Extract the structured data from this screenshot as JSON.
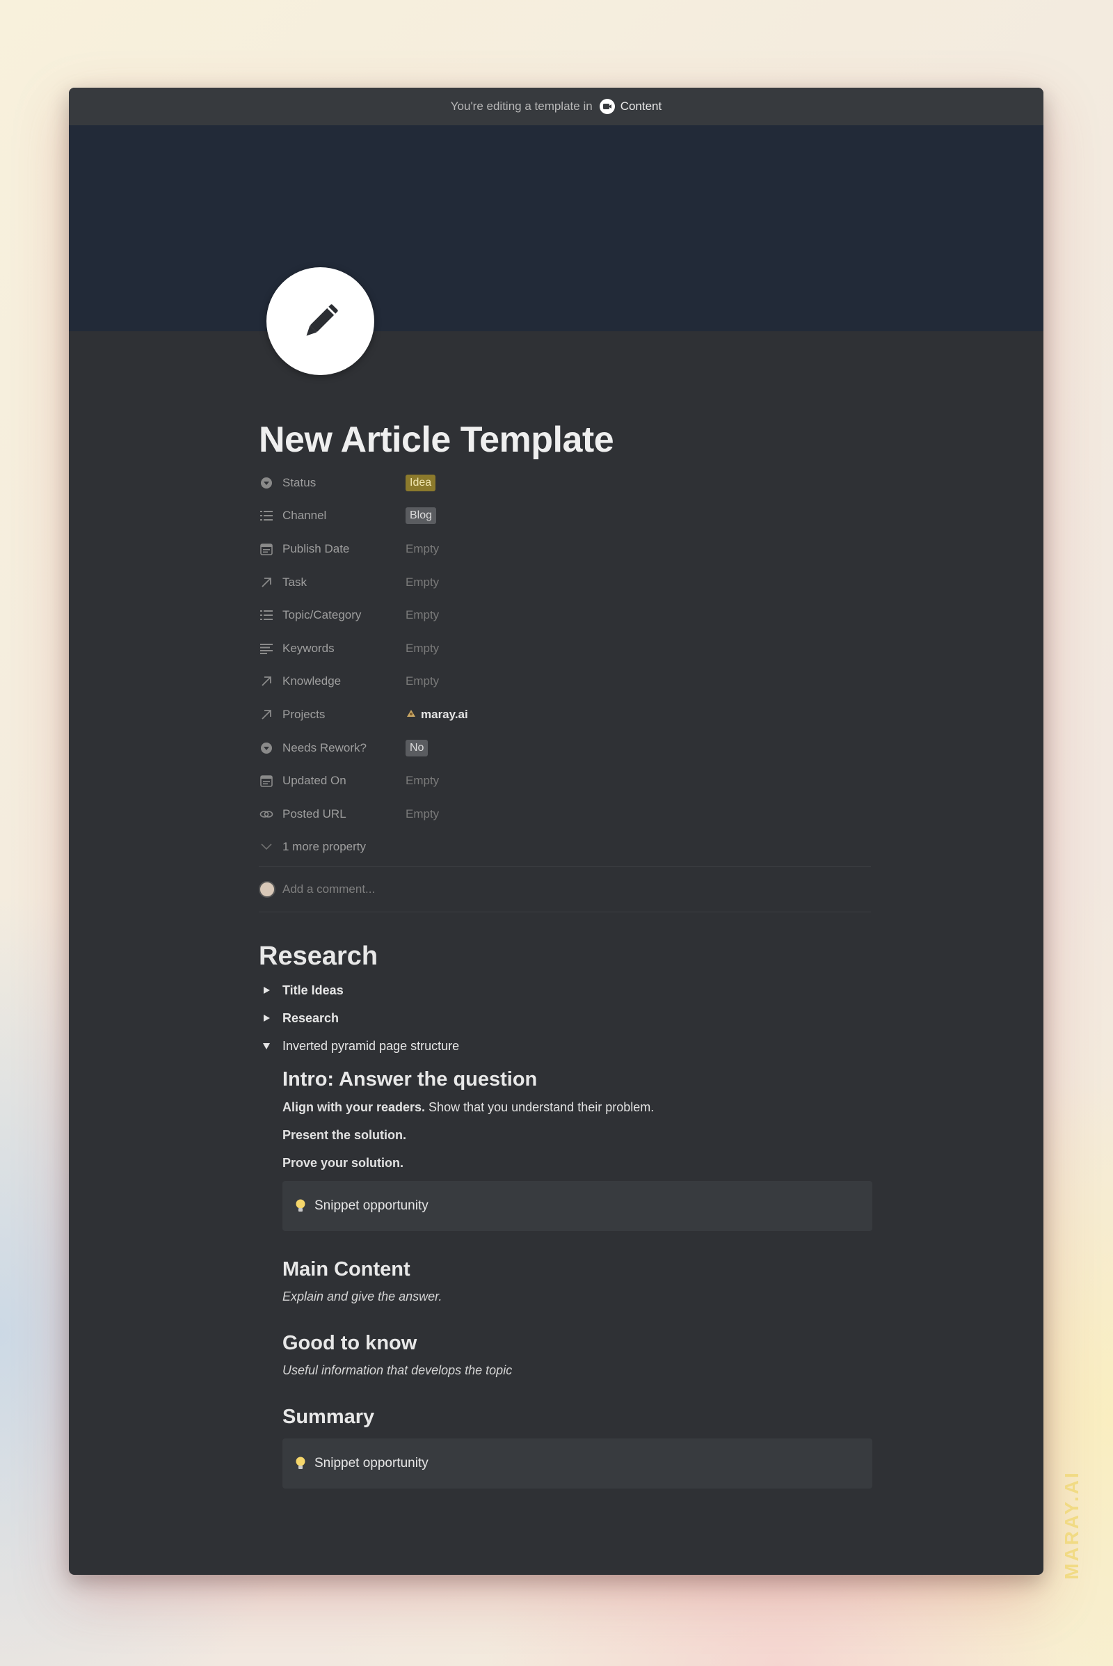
{
  "banner": {
    "prefix": "You're editing a template in",
    "workspace": "Content"
  },
  "page": {
    "icon": "pencil-icon",
    "title": "New Article Template"
  },
  "properties": [
    {
      "name": "Status",
      "icon": "status-icon",
      "value": "Idea",
      "kind": "tag-yellow"
    },
    {
      "name": "Channel",
      "icon": "list-icon",
      "value": "Blog",
      "kind": "tag-gray"
    },
    {
      "name": "Publish Date",
      "icon": "calendar-icon",
      "value": "Empty",
      "kind": "empty"
    },
    {
      "name": "Task",
      "icon": "relation-arrow-icon",
      "value": "Empty",
      "kind": "empty"
    },
    {
      "name": "Topic/Category",
      "icon": "list-icon",
      "value": "Empty",
      "kind": "empty"
    },
    {
      "name": "Keywords",
      "icon": "text-icon",
      "value": "Empty",
      "kind": "empty"
    },
    {
      "name": "Knowledge",
      "icon": "relation-arrow-icon",
      "value": "Empty",
      "kind": "empty"
    },
    {
      "name": "Projects",
      "icon": "relation-arrow-icon",
      "value": "maray.ai",
      "kind": "relation"
    },
    {
      "name": "Needs Rework?",
      "icon": "status-icon",
      "value": "No",
      "kind": "tag-gray"
    },
    {
      "name": "Updated On",
      "icon": "calendar-icon",
      "value": "Empty",
      "kind": "empty"
    },
    {
      "name": "Posted URL",
      "icon": "link-icon",
      "value": "Empty",
      "kind": "empty"
    }
  ],
  "more_property": "1 more property",
  "comment_placeholder": "Add a comment...",
  "body": {
    "heading": "Research",
    "toggles": [
      {
        "label": "Title Ideas",
        "open": false
      },
      {
        "label": "Research",
        "open": false
      },
      {
        "label": "Inverted pyramid page structure",
        "open": true
      }
    ],
    "intro": {
      "heading": "Intro: Answer the question",
      "line1_bold": "Align with your readers.",
      "line1_rest": " Show that you understand their problem.",
      "line2": "Present the solution.",
      "line3": "Prove your solution.",
      "callout": "Snippet opportunity"
    },
    "main": {
      "heading": "Main Content",
      "text": "Explain and give the answer."
    },
    "good": {
      "heading": "Good to know",
      "text": "Useful information that develops the topic"
    },
    "summary": {
      "heading": "Summary",
      "callout": "Snippet opportunity"
    }
  },
  "watermark": "MARAY.AI"
}
